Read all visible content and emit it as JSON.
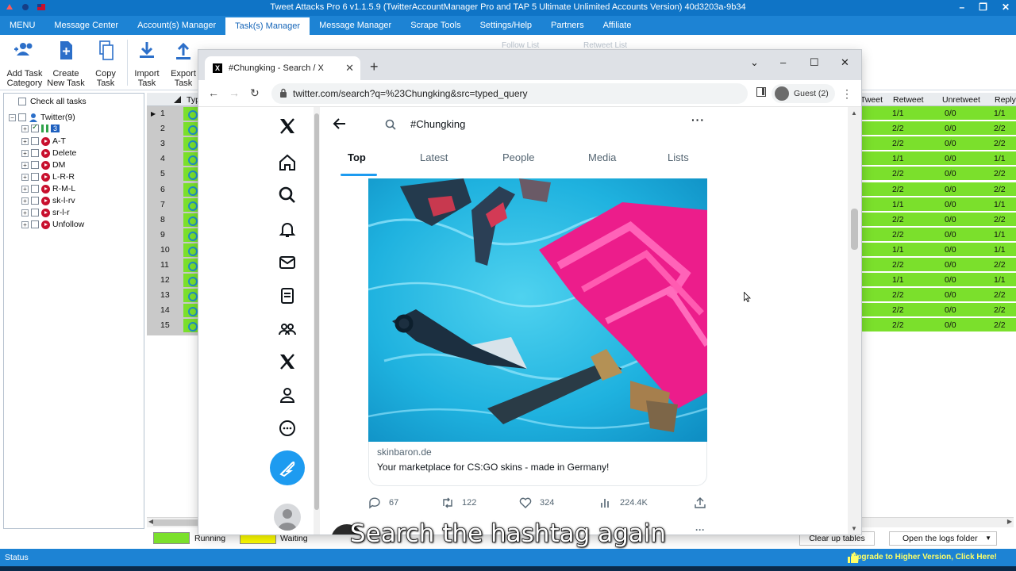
{
  "app": {
    "title": "Tweet Attacks Pro 6 v1.1.5.9 (TwitterAccountManager Pro and TAP 5 Ultimate Unlimited Accounts Version) 40d3203a-9b34",
    "window_controls": [
      "–",
      "❐",
      "✕"
    ]
  },
  "menubar": {
    "items": [
      "MENU",
      "Message Center",
      "Account(s) Manager",
      "Task(s) Manager",
      "Message Manager",
      "Scrape Tools",
      "Settings/Help",
      "Partners",
      "Affiliate"
    ],
    "active": "Task(s) Manager"
  },
  "ribbon": {
    "add_task_category": "Add Task\nCategory",
    "add_task_category_l1": "Add Task",
    "add_task_category_l2": "Category",
    "create_l1": "Create",
    "create_l2": "New Task",
    "copy_l1": "Copy",
    "copy_l2": "Task",
    "import_l1": "Import",
    "import_l2": "Task",
    "export_l1": "Export",
    "export_l2": "Task",
    "follow_list": "Follow List",
    "retweet_list": "Retweet List"
  },
  "tree": {
    "check_all": "Check all tasks",
    "root": "Twitter(9)",
    "selected_badge": "3",
    "children": [
      "A-T",
      "Delete",
      "DM",
      "L-R-R",
      "R-M-L",
      "sk-l-rv",
      "sr-l-r",
      "Unfollow"
    ]
  },
  "grid": {
    "type_header": "Typ",
    "row_numbers": [
      "1",
      "2",
      "3",
      "4",
      "5",
      "6",
      "7",
      "8",
      "9",
      "10",
      "11",
      "12",
      "13",
      "14",
      "15"
    ],
    "right_headers": [
      "Tweet",
      "Retweet",
      "Unretweet",
      "Reply"
    ],
    "right_rows": [
      [
        "1/1",
        "0/0",
        "1/1"
      ],
      [
        "2/2",
        "0/0",
        "2/2"
      ],
      [
        "2/2",
        "0/0",
        "2/2"
      ],
      [
        "1/1",
        "0/0",
        "1/1"
      ],
      [
        "2/2",
        "0/0",
        "2/2"
      ],
      [
        "2/2",
        "0/0",
        "2/2"
      ],
      [
        "1/1",
        "0/0",
        "1/1"
      ],
      [
        "2/2",
        "0/0",
        "2/2"
      ],
      [
        "2/2",
        "0/0",
        "1/1"
      ],
      [
        "1/1",
        "0/0",
        "1/1"
      ],
      [
        "2/2",
        "0/0",
        "2/2"
      ],
      [
        "1/1",
        "0/0",
        "1/1"
      ],
      [
        "2/2",
        "0/0",
        "2/2"
      ],
      [
        "2/2",
        "0/0",
        "2/2"
      ],
      [
        "2/2",
        "0/0",
        "2/2"
      ]
    ]
  },
  "legend": {
    "running": "Running",
    "waiting": "Waiting",
    "running_color": "#7be02c",
    "waiting_color": "#ffff00",
    "clear_tables": "Clear up tables",
    "open_logs": "Open the logs folder"
  },
  "statusbar": {
    "status": "Status",
    "upgrade": "Upgrade to Higher Version, Click Here!"
  },
  "browser": {
    "tab_title": "#Chungking - Search / X",
    "favicon": "X",
    "url": "twitter.com/search?q=%23Chungking&src=typed_query",
    "profile_label": "Guest (2)"
  },
  "twitter": {
    "search_query": "#Chungking",
    "tabs": [
      "Top",
      "Latest",
      "People",
      "Media",
      "Lists"
    ],
    "active_tab": "Top",
    "card_domain": "skinbaron.de",
    "card_description": "Your marketplace for CS:GO skins - made in Germany!",
    "actions": {
      "replies": "67",
      "retweets": "122",
      "likes": "324",
      "views": "224.4K"
    }
  },
  "subtitle": "Search the hashtag again",
  "colors": {
    "accent": "#1d83d4",
    "twitter_blue": "#1d9bf0",
    "grid_green": "#7be02c"
  }
}
